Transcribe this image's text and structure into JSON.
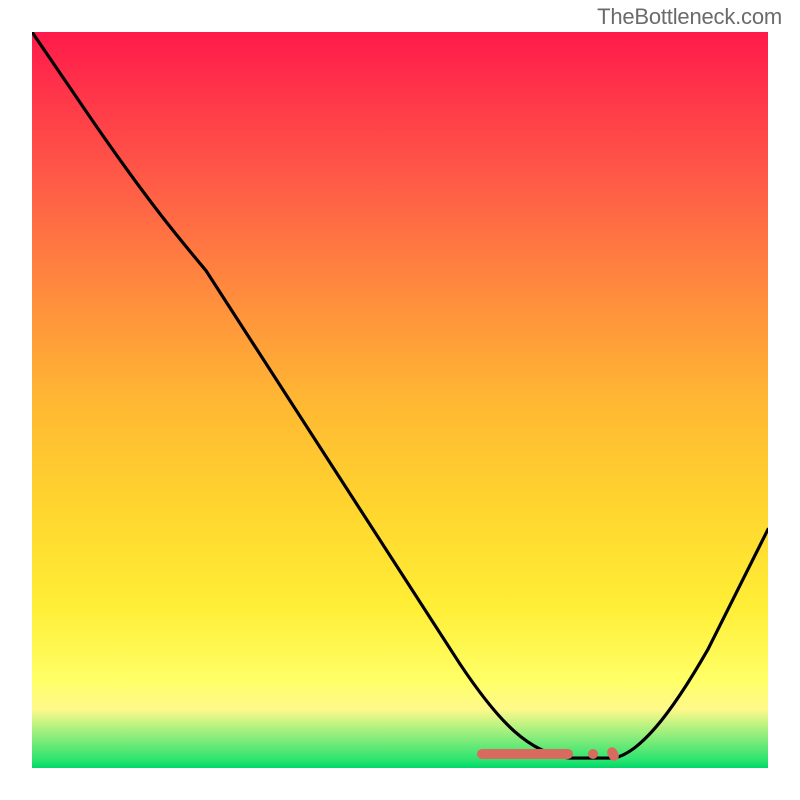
{
  "watermark": "TheBottleneck.com",
  "chart_data": {
    "type": "line",
    "title": "",
    "xlabel": "",
    "ylabel": "",
    "xlim": [
      0,
      100
    ],
    "ylim": [
      0,
      100
    ],
    "grid": false,
    "legend": false,
    "background_gradient": {
      "top": "#ff1a4b",
      "mid": "#ffd62e",
      "bottom": "#00d86a"
    },
    "series": [
      {
        "name": "bottleneck-curve",
        "color": "#000000",
        "x": [
          0,
          8,
          18,
          28,
          38,
          48,
          58,
          64,
          70,
          75,
          80,
          86,
          92,
          100
        ],
        "y": [
          100,
          88,
          76,
          60,
          44,
          30,
          16,
          8,
          2,
          0,
          0,
          8,
          18,
          34
        ]
      }
    ],
    "annotations": [
      {
        "name": "optimal-range-marker",
        "x_start": 60,
        "x_end": 80,
        "y": 0,
        "color": "#d86a5f"
      }
    ]
  }
}
